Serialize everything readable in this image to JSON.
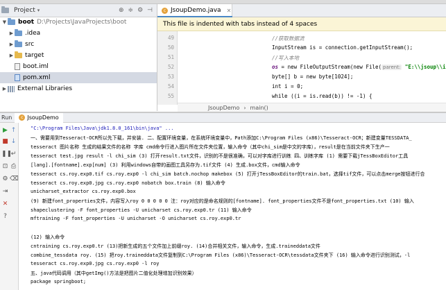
{
  "project_panel": {
    "title": "Project",
    "tree": [
      {
        "label": "boot",
        "path": "D:\\Projects\\JavaProjects\\boot",
        "icon": "folder-icon",
        "expanded": true
      },
      {
        "label": ".idea",
        "icon": "folder-icon"
      },
      {
        "label": "src",
        "icon": "folder-icon"
      },
      {
        "label": "target",
        "icon": "folder-icon"
      },
      {
        "label": "boot.iml",
        "icon": "file-icon"
      },
      {
        "label": "pom.xml",
        "icon": "maven-file-icon"
      },
      {
        "label": "External Libraries",
        "icon": "library-icon"
      }
    ]
  },
  "editor": {
    "tab_label": "JsoupDemo.java",
    "notice": "This file is indented with tabs instead of 4 spaces",
    "line_numbers": [
      "49",
      "50",
      "51",
      "52",
      "53",
      "54",
      "55",
      "56"
    ],
    "code": {
      "l1": "//获取数据流",
      "l2": "InputStream is = connection.getInputStream();",
      "l3": "//写入本地",
      "l4_a": "os",
      "l4_b": " = new FileOutputStream(new File(",
      "l4_hint": "parent:",
      "l4_c": "\"E:\\\\jsoup\\\\i",
      "l5": "byte[] b = new byte[1024];",
      "l6": "int i = 0;",
      "l7": "while ((i = is.read(b)) != -1) {"
    },
    "breadcrumb": [
      "JsoupDemo",
      "main()"
    ]
  },
  "run_panel": {
    "label": "Run",
    "tab_label": "JsoupDemo",
    "console_lines": [
      "\"C:\\Program Files\\Java\\jdk1.8.0_161\\bin\\java\" ...",
      "一、需要用到Tesseract-OCR所以先下载，并安装. 二、配置环境变量，在系统环境变量中，Path添加C:\\Program Files (x86)\\Tesseract-OCR；新建变量TESSDATA_",
      "tesseract 图片名称 生成的结果文件的名称 字库  cmd命令行进入图片所在文件夹位置，输入命令（其中chi_sim是中文的字库），result是在当前文件夹下生产一",
      "tesseract test.jpg result -l chi_sim  (3) 打开result.txt文件，识别的不是很准确，可以对字库进行训练 四、训练字库  (1) 需要下载jTessBoxEditor工具",
      "[lang].[fontname].exp[num]  (3) 利用windows自带的画图工具另存为.tif文件  (4) 生成.box文件，cmd输入命令",
      "tesseract  cs.roy.exp0.tif cs.roy.exp0 -l chi_sim batch.nochop makebox  (5) 打开jTessBoxEditor的train.bat，选择tif文件，可以点击merge按钮进行合",
      "tesseract  cs.roy.exp0.jpg cs.roy.exp0  nobatch box.train  (8) 输入命令",
      "unicharset_extractor cs.roy.exp0.box",
      "  (9) 新建font_properties文件，内容写入roy 0 0 0 0 0    注：roy对应的是命名规则的[fontname]. font_properties文件不是font_properties.txt  (10) 输入",
      "shapeclustering -F font_properties -U unicharset cs.roy.exp0.tr  (11) 输入命令",
      "mftraining -F font_properties -U unicharset -O unicharset cs.roy.exp0.tr",
      "",
      "  (12) 输入命令",
      "cntraining cs.roy.exp0.tr (13)把新生成的五个文件加上前缀roy.  (14)合并相关文件，输入命令，生成.traineddata文件",
      "combine_tessdata roy.  (15) 把roy.traineddata文件复制到C:\\Program Files (x86)\\Tesseract-OCR\\tessdata文件夹下      (16) 输入命令进行识别测试，-l",
      "tesseract cs.roy.exp0.jpg cs.roy.exp0 -l roy",
      "五、java代码调用（其中getImg()方法是把图片二值化处理增加识别效果）",
      "package springboot;"
    ]
  }
}
